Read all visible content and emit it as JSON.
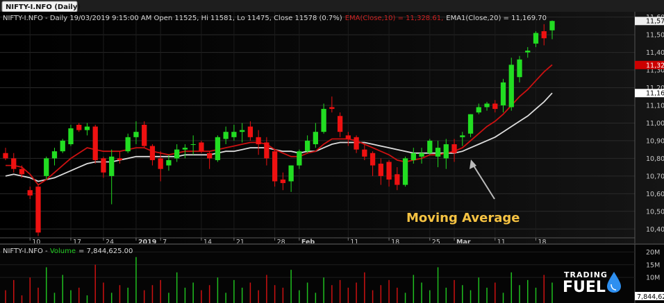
{
  "chart_data": [
    {
      "type": "candlestick",
      "symbol_tab": "NIFTY-I.NFO (Daily)",
      "header": {
        "prefix": "NIFTY-I.NFO - Daily 19/03/2019 9:15:00 AM Open 11525, Hi 11581, Lo 11475, Close 11578 (0.7%)",
        "ema10": "EMA(Close,10) = 11,328.61,",
        "ema20": "EMA1(Close,20) = 11,169.70"
      },
      "colors": {
        "up": "#22dd22",
        "down": "#ee1111",
        "ema10": "#cc1111",
        "ema20": "#dddddd",
        "grid": "#2a2a2a",
        "text": "#c8c8c8"
      },
      "y_ticks": [
        "11,600",
        "11,500",
        "11,400",
        "11,300",
        "11,200",
        "11,100",
        "11,000",
        "10,900",
        "10,800",
        "10,700",
        "10,600",
        "10,500",
        "10,400"
      ],
      "ylim": [
        10350,
        11630
      ],
      "price_labels": {
        "close": "11,578",
        "ema10": "11,328.6",
        "ema20": "11,169.7"
      },
      "x_labels": [
        {
          "label": "10",
          "i": 3,
          "bold": false
        },
        {
          "label": "17",
          "i": 8,
          "bold": false
        },
        {
          "label": "24",
          "i": 12,
          "bold": false
        },
        {
          "label": "2019",
          "i": 16,
          "bold": true
        },
        {
          "label": "7",
          "i": 19,
          "bold": false
        },
        {
          "label": "14",
          "i": 24,
          "bold": false
        },
        {
          "label": "21",
          "i": 28,
          "bold": false
        },
        {
          "label": "28",
          "i": 33,
          "bold": false
        },
        {
          "label": "Feb",
          "i": 36,
          "bold": true
        },
        {
          "label": "11",
          "i": 42,
          "bold": false
        },
        {
          "label": "18",
          "i": 47,
          "bold": false
        },
        {
          "label": "25",
          "i": 52,
          "bold": false
        },
        {
          "label": "Mar",
          "i": 55,
          "bold": true
        },
        {
          "label": "11",
          "i": 60,
          "bold": false
        },
        {
          "label": "18",
          "i": 65,
          "bold": false
        }
      ],
      "ohlc": [
        [
          10830,
          10860,
          10790,
          10800
        ],
        [
          10800,
          10830,
          10720,
          10740
        ],
        [
          10740,
          10760,
          10690,
          10710
        ],
        [
          10620,
          10640,
          10570,
          10590
        ],
        [
          10640,
          10650,
          10360,
          10380
        ],
        [
          10700,
          10810,
          10680,
          10800
        ],
        [
          10800,
          10860,
          10760,
          10840
        ],
        [
          10840,
          10910,
          10830,
          10900
        ],
        [
          10880,
          10990,
          10870,
          10970
        ],
        [
          10990,
          11000,
          10950,
          10960
        ],
        [
          10960,
          11000,
          10930,
          10980
        ],
        [
          10980,
          10990,
          10770,
          10790
        ],
        [
          10800,
          10810,
          10690,
          10720
        ],
        [
          10700,
          10850,
          10540,
          10810
        ],
        [
          10800,
          10840,
          10770,
          10790
        ],
        [
          10840,
          10940,
          10830,
          10920
        ],
        [
          10920,
          11010,
          10880,
          10950
        ],
        [
          10990,
          11010,
          10860,
          10870
        ],
        [
          10870,
          10880,
          10760,
          10790
        ],
        [
          10800,
          10840,
          10670,
          10740
        ],
        [
          10760,
          10820,
          10730,
          10790
        ],
        [
          10800,
          10880,
          10780,
          10850
        ],
        [
          10850,
          10880,
          10800,
          10860
        ],
        [
          10880,
          10930,
          10820,
          10880
        ],
        [
          10890,
          10900,
          10830,
          10840
        ],
        [
          10830,
          10840,
          10740,
          10800
        ],
        [
          10790,
          10930,
          10780,
          10920
        ],
        [
          10910,
          10980,
          10880,
          10950
        ],
        [
          10920,
          10990,
          10900,
          10950
        ],
        [
          10950,
          11000,
          10890,
          10960
        ],
        [
          10980,
          11010,
          10900,
          10920
        ],
        [
          10920,
          10960,
          10820,
          10880
        ],
        [
          10890,
          10920,
          10760,
          10800
        ],
        [
          10840,
          10850,
          10640,
          10670
        ],
        [
          10680,
          10720,
          10620,
          10660
        ],
        [
          10670,
          10760,
          10610,
          10760
        ],
        [
          10760,
          10850,
          10740,
          10840
        ],
        [
          10840,
          10930,
          10830,
          10900
        ],
        [
          10880,
          11000,
          10860,
          10950
        ],
        [
          10950,
          11110,
          10940,
          11080
        ],
        [
          11090,
          11150,
          11060,
          11080
        ],
        [
          11040,
          11060,
          10920,
          10950
        ],
        [
          10930,
          10950,
          10870,
          10910
        ],
        [
          10920,
          10930,
          10830,
          10850
        ],
        [
          10850,
          10880,
          10790,
          10810
        ],
        [
          10830,
          10840,
          10700,
          10760
        ],
        [
          10770,
          10800,
          10650,
          10700
        ],
        [
          10780,
          10790,
          10640,
          10680
        ],
        [
          10710,
          10750,
          10620,
          10650
        ],
        [
          10650,
          10810,
          10640,
          10800
        ],
        [
          10790,
          10860,
          10770,
          10830
        ],
        [
          10810,
          10860,
          10770,
          10830
        ],
        [
          10830,
          10910,
          10820,
          10900
        ],
        [
          10810,
          10900,
          10750,
          10860
        ],
        [
          10800,
          10910,
          10740,
          10880
        ],
        [
          10880,
          10910,
          10780,
          10830
        ],
        [
          10920,
          10950,
          10870,
          10930
        ],
        [
          10940,
          11050,
          10920,
          11050
        ],
        [
          11060,
          11110,
          11050,
          11090
        ],
        [
          11090,
          11120,
          11070,
          11110
        ],
        [
          11110,
          11130,
          11060,
          11080
        ],
        [
          11100,
          11250,
          11060,
          11230
        ],
        [
          11090,
          11370,
          11070,
          11330
        ],
        [
          11260,
          11380,
          11230,
          11360
        ],
        [
          11400,
          11430,
          11370,
          11410
        ],
        [
          11450,
          11520,
          11430,
          11510
        ],
        [
          11520,
          11560,
          11440,
          11480
        ],
        [
          11525,
          11581,
          11475,
          11578
        ]
      ],
      "ema10": [
        10760,
        10760,
        10750,
        10710,
        10650,
        10680,
        10720,
        10760,
        10800,
        10830,
        10860,
        10850,
        10840,
        10840,
        10840,
        10850,
        10860,
        10860,
        10840,
        10830,
        10820,
        10830,
        10840,
        10840,
        10840,
        10840,
        10850,
        10860,
        10870,
        10880,
        10890,
        10890,
        10880,
        10850,
        10830,
        10810,
        10810,
        10830,
        10840,
        10880,
        10910,
        10910,
        10910,
        10900,
        10880,
        10860,
        10840,
        10820,
        10790,
        10780,
        10790,
        10800,
        10820,
        10820,
        10830,
        10840,
        10860,
        10900,
        10940,
        10980,
        11010,
        11050,
        11100,
        11150,
        11190,
        11240,
        11290,
        11330
      ],
      "ema20": [
        10700,
        10710,
        10700,
        10690,
        10670,
        10680,
        10690,
        10710,
        10730,
        10750,
        10770,
        10780,
        10780,
        10780,
        10790,
        10800,
        10810,
        10810,
        10810,
        10810,
        10810,
        10810,
        10820,
        10820,
        10820,
        10820,
        10830,
        10840,
        10840,
        10850,
        10860,
        10860,
        10860,
        10850,
        10840,
        10840,
        10830,
        10840,
        10840,
        10860,
        10880,
        10890,
        10890,
        10890,
        10890,
        10880,
        10870,
        10860,
        10850,
        10840,
        10830,
        10830,
        10830,
        10830,
        10830,
        10830,
        10840,
        10860,
        10880,
        10900,
        10920,
        10950,
        10980,
        11010,
        11040,
        11080,
        11120,
        11170
      ],
      "volume_header": {
        "prefix": "NIFTY-I.NFO - ",
        "label": "Volume",
        "value": "= 7,844,625.00"
      },
      "volume_ticks": [
        "20M",
        "15M",
        "10M"
      ],
      "volume_value_label": "7,844,62",
      "volume": [
        5,
        9,
        3,
        10,
        6,
        14,
        4,
        11,
        5,
        6,
        3,
        15,
        8,
        4,
        7,
        6,
        18,
        5,
        7,
        9,
        4,
        12,
        6,
        8,
        5,
        7,
        10,
        4,
        9,
        6,
        8,
        5,
        11,
        7,
        6,
        13,
        5,
        8,
        4,
        10,
        7,
        9,
        6,
        8,
        12,
        5,
        7,
        9,
        6,
        4,
        11,
        8,
        5,
        14,
        6,
        9,
        7,
        5,
        10,
        6,
        8,
        4,
        12,
        7,
        9,
        6,
        11,
        8
      ]
    }
  ],
  "annotation": {
    "text": "Moving Average"
  },
  "brand": {
    "line1": "TRADING",
    "line2": "FUEL"
  }
}
